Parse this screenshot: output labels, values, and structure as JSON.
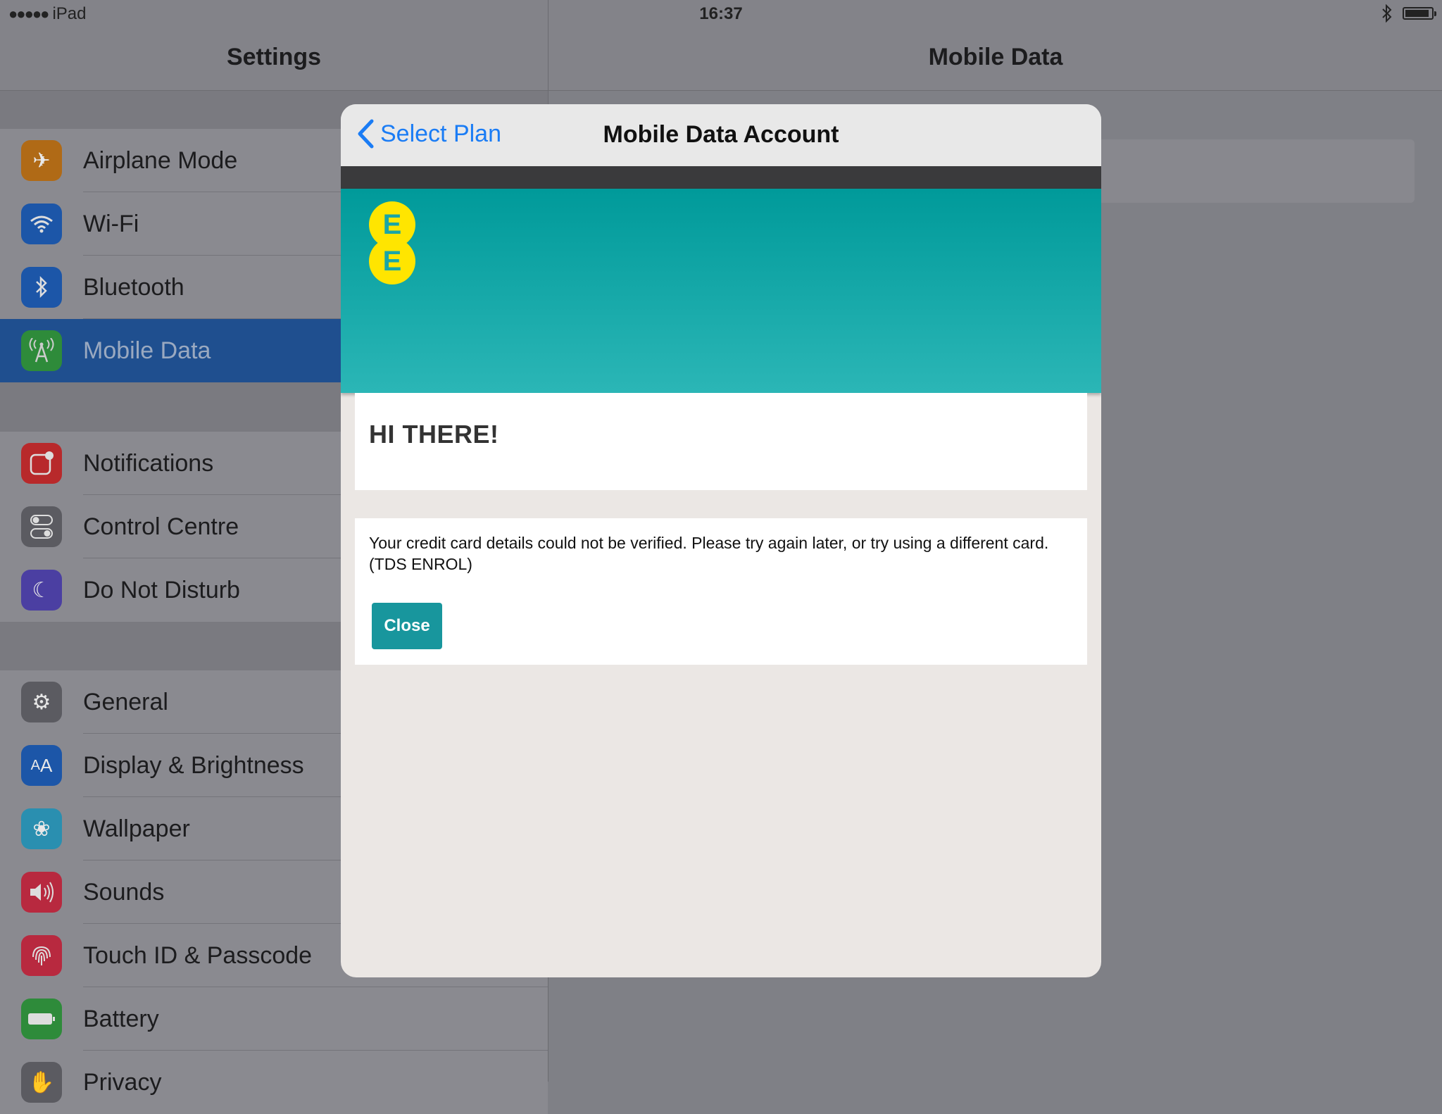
{
  "status_bar": {
    "carrier": "iPad",
    "time": "16:37"
  },
  "master": {
    "title": "Settings",
    "groups": [
      {
        "items": [
          {
            "label": "Airplane Mode",
            "icon": "airplane-icon",
            "color": "#b06a16"
          },
          {
            "label": "Wi-Fi",
            "icon": "wifi-icon",
            "color": "#1c56a8"
          },
          {
            "label": "Bluetooth",
            "icon": "bluetooth-icon",
            "color": "#1c56a8"
          },
          {
            "label": "Mobile Data",
            "icon": "antenna-icon",
            "color": "#2e8b3a",
            "selected": true
          }
        ]
      },
      {
        "items": [
          {
            "label": "Notifications",
            "icon": "notifications-icon",
            "color": "#b8292b"
          },
          {
            "label": "Control Centre",
            "icon": "switches-icon",
            "color": "#5b5b61"
          },
          {
            "label": "Do Not Disturb",
            "icon": "moon-icon",
            "color": "#4b3fa2"
          }
        ]
      },
      {
        "items": [
          {
            "label": "General",
            "icon": "gear-icon",
            "color": "#5b5b61"
          },
          {
            "label": "Display & Brightness",
            "icon": "text-size-icon",
            "color": "#1c56a8"
          },
          {
            "label": "Wallpaper",
            "icon": "flower-icon",
            "color": "#2a8fb0"
          },
          {
            "label": "Sounds",
            "icon": "speaker-icon",
            "color": "#b8293f"
          },
          {
            "label": "Touch ID & Passcode",
            "icon": "fingerprint-icon",
            "color": "#b8293f"
          },
          {
            "label": "Battery",
            "icon": "battery-icon",
            "color": "#2e8b3a"
          },
          {
            "label": "Privacy",
            "icon": "hand-icon",
            "color": "#5b5b61"
          }
        ]
      }
    ]
  },
  "detail": {
    "title": "Mobile Data"
  },
  "modal": {
    "back_label": "Select Plan",
    "title": "Mobile Data Account",
    "brand_color": "#ffe500",
    "teal_color": "#18969d",
    "greeting": "HI THERE!",
    "message": "Your credit card details could not be verified. Please try again later, or try using a different card.(TDS ENROL)",
    "close_label": "Close"
  }
}
